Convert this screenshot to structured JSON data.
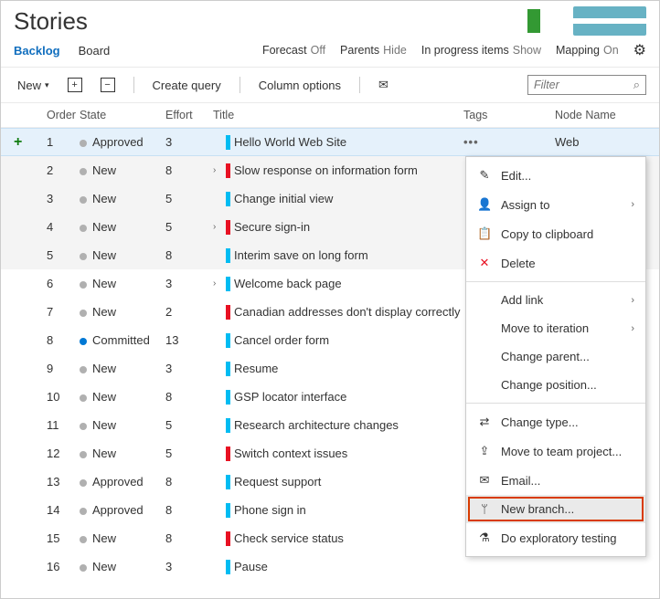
{
  "header": {
    "title": "Stories"
  },
  "tabs": {
    "backlog": "Backlog",
    "board": "Board"
  },
  "toggles": {
    "forecast_label": "Forecast",
    "forecast_val": "Off",
    "parents_label": "Parents",
    "parents_val": "Hide",
    "inprogress_label": "In progress items",
    "inprogress_val": "Show",
    "mapping_label": "Mapping",
    "mapping_val": "On"
  },
  "toolbar": {
    "new": "New",
    "create_query": "Create query",
    "column_options": "Column options",
    "filter_placeholder": "Filter"
  },
  "columns": {
    "order": "Order",
    "state": "State",
    "effort": "Effort",
    "title": "Title",
    "tags": "Tags",
    "node": "Node Name"
  },
  "node_first": "Web",
  "rows": [
    {
      "order": "1",
      "state": "Approved",
      "dot": "#b0b0b0",
      "effort": "3",
      "bar": "#00bcf2",
      "title": "Hello World Web Site",
      "chev": false,
      "selected": true,
      "ellipsis": true
    },
    {
      "order": "2",
      "state": "New",
      "dot": "#b0b0b0",
      "effort": "8",
      "bar": "#e81123",
      "title": "Slow response on information form",
      "chev": true,
      "shade": true
    },
    {
      "order": "3",
      "state": "New",
      "dot": "#b0b0b0",
      "effort": "5",
      "bar": "#00bcf2",
      "title": "Change initial view",
      "chev": false,
      "shade": true
    },
    {
      "order": "4",
      "state": "New",
      "dot": "#b0b0b0",
      "effort": "5",
      "bar": "#e81123",
      "title": "Secure sign-in",
      "chev": true,
      "shade": true
    },
    {
      "order": "5",
      "state": "New",
      "dot": "#b0b0b0",
      "effort": "8",
      "bar": "#00bcf2",
      "title": "Interim save on long form",
      "chev": false,
      "shade": true
    },
    {
      "order": "6",
      "state": "New",
      "dot": "#b0b0b0",
      "effort": "3",
      "bar": "#00bcf2",
      "title": "Welcome back page",
      "chev": true
    },
    {
      "order": "7",
      "state": "New",
      "dot": "#b0b0b0",
      "effort": "2",
      "bar": "#e81123",
      "title": "Canadian addresses don't display correctly"
    },
    {
      "order": "8",
      "state": "Committed",
      "dot": "#0078d4",
      "effort": "13",
      "bar": "#00bcf2",
      "title": "Cancel order form"
    },
    {
      "order": "9",
      "state": "New",
      "dot": "#b0b0b0",
      "effort": "3",
      "bar": "#00bcf2",
      "title": "Resume"
    },
    {
      "order": "10",
      "state": "New",
      "dot": "#b0b0b0",
      "effort": "8",
      "bar": "#00bcf2",
      "title": "GSP locator interface"
    },
    {
      "order": "11",
      "state": "New",
      "dot": "#b0b0b0",
      "effort": "5",
      "bar": "#00bcf2",
      "title": "Research architecture changes"
    },
    {
      "order": "12",
      "state": "New",
      "dot": "#b0b0b0",
      "effort": "5",
      "bar": "#e81123",
      "title": "Switch context issues"
    },
    {
      "order": "13",
      "state": "Approved",
      "dot": "#b0b0b0",
      "effort": "8",
      "bar": "#00bcf2",
      "title": "Request support"
    },
    {
      "order": "14",
      "state": "Approved",
      "dot": "#b0b0b0",
      "effort": "8",
      "bar": "#00bcf2",
      "title": "Phone sign in"
    },
    {
      "order": "15",
      "state": "New",
      "dot": "#b0b0b0",
      "effort": "8",
      "bar": "#e81123",
      "title": "Check service status"
    },
    {
      "order": "16",
      "state": "New",
      "dot": "#b0b0b0",
      "effort": "3",
      "bar": "#00bcf2",
      "title": "Pause"
    }
  ],
  "ctx": {
    "edit": "Edit...",
    "assign": "Assign to",
    "copy": "Copy to clipboard",
    "delete": "Delete",
    "addlink": "Add link",
    "moveiter": "Move to iteration",
    "changeparent": "Change parent...",
    "changepos": "Change position...",
    "changetype": "Change type...",
    "moveproj": "Move to team project...",
    "email": "Email...",
    "newbranch": "New branch...",
    "explore": "Do exploratory testing"
  }
}
